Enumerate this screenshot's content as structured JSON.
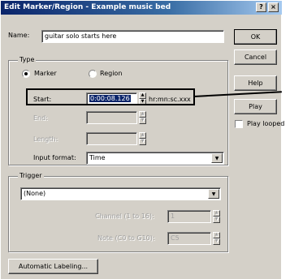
{
  "window": {
    "title": "Edit Marker/Region - Example music bed",
    "help_btn": "?",
    "close_btn": "×"
  },
  "name": {
    "label": "Name:",
    "value": "guitar solo starts here"
  },
  "type": {
    "group_label": "Type",
    "marker_label": "Marker",
    "region_label": "Region",
    "selected": "Marker"
  },
  "start": {
    "label": "Start:",
    "value": "0:00:08.126",
    "format_hint": "hr:mn:sc.xxx"
  },
  "end": {
    "label": "End:",
    "value": ""
  },
  "length": {
    "label": "Length:",
    "value": ""
  },
  "input_format": {
    "label": "Input format:",
    "value": "Time"
  },
  "trigger": {
    "group_label": "Trigger",
    "value": "(None)",
    "channel_label": "Channel (1 to 16):",
    "channel_value": "1",
    "note_label": "Note (C0 to G10):",
    "note_value": "C5"
  },
  "buttons": {
    "ok": "OK",
    "cancel": "Cancel",
    "help": "Help",
    "play": "Play",
    "play_looped": "Play looped",
    "automatic_labeling": "Automatic Labeling..."
  },
  "colors": {
    "highlight_box": "#000000",
    "selection": "#0a246a",
    "title_start": "#0a246a"
  }
}
